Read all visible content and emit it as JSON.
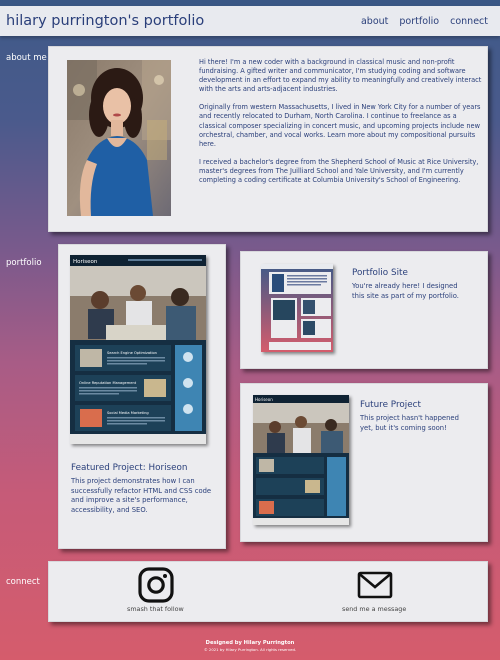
{
  "header": {
    "title": "hilary purrington's portfolio",
    "nav": [
      "about",
      "portfolio",
      "connect"
    ]
  },
  "about": {
    "label": "about me",
    "paragraphs": [
      "Hi there! I'm a new coder with a background in classical music and non-profit fundraising. A gifted writer and communicator, I'm studying coding and software development in an effort to expand my ability to meaningfully and creatively interact with the arts and arts-adjacent industries.",
      "Originally from western Massachusetts, I lived in New York City for a number of years and recently relocated to Durham, North Carolina. I continue to freelance as a classical composer specializing in concert music, and upcoming projects include new orchestral, chamber, and vocal works. Learn more about my compositional pursuits",
      "I received a bachelor's degree from the Shepherd School of Music at Rice University, master's degrees from The Juilliard School and Yale University, and I'm currently completing a coding certificate at Columbia University's School of Engineering."
    ],
    "link_text": "here",
    "link_after": "."
  },
  "portfolio": {
    "label": "portfolio",
    "featured": {
      "title": "Featured Project: Horiseon",
      "description": "This project demonstrates how I can successfully refactor HTML and CSS code and improve a site's performance, accessibility, and SEO.",
      "thumb_brand": "Horiseon",
      "thumb_sections": [
        "Search Engine Optimization",
        "Online Reputation Management",
        "Social Media Marketing"
      ]
    },
    "site": {
      "title": "Portfolio Site",
      "description": "You're already here! I designed this site as part of my portfolio."
    },
    "future": {
      "title": "Future Project",
      "description": "This project hasn't happened yet, but it's coming soon!",
      "thumb_brand": "Horiseon"
    }
  },
  "connect": {
    "label": "connect",
    "instagram": "smash that follow",
    "email": "send me a message"
  },
  "footer": {
    "line1": "Designed by Hilary Purrington",
    "line2": "© 2021 by Hilary Purrington. All rights reserved."
  },
  "colors": {
    "navy": "#2a3f7a",
    "panel": "#ececef",
    "gradient_top": "#3f5a88",
    "gradient_bottom": "#d55c6c"
  }
}
